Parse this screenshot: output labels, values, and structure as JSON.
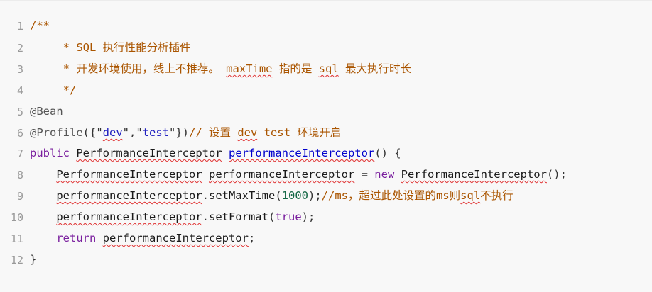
{
  "line_numbers": [
    "1",
    "2",
    "3",
    "4",
    "5",
    "6",
    "7",
    "8",
    "9",
    "10",
    "11",
    "12"
  ],
  "code": {
    "l1": {
      "open": "/**"
    },
    "l2": {
      "text": "     * SQL 执行性能分析插件"
    },
    "l3": {
      "pre": "     * 开发环境使用，线上不推荐。 ",
      "w1": "maxTime",
      "mid": " 指的是 ",
      "w2": "sql",
      "post": " 最大执行时长"
    },
    "l4": {
      "close": "     */"
    },
    "l5": {
      "annotation": "@Bean"
    },
    "l6": {
      "annotation": "@Profile",
      "p1": "({\"",
      "s1": "dev",
      "p2": "\",\"",
      "s2": "test",
      "p3": "\"})",
      "c_pre": "// 设置 ",
      "c_w": "dev",
      "c_post": " test 环境开启"
    },
    "l7": {
      "kw": "public",
      "sp1": " ",
      "type": "PerformanceInterceptor",
      "sp2": " ",
      "method": "performanceInterceptor",
      "rest": "() {"
    },
    "l8": {
      "indent": "    ",
      "type": "PerformanceInterceptor",
      "sp": " ",
      "var": "performanceInterceptor",
      "eq": " = ",
      "kw": "new",
      "sp2": " ",
      "ctor": "PerformanceInterceptor",
      "end": "();"
    },
    "l9": {
      "indent": "    ",
      "obj": "performanceInterceptor",
      "dot": ".",
      "call": "setMaxTime",
      "open": "(",
      "num": "1000",
      "close": ");",
      "c_pre": "//ms，超过此处设置的ms则",
      "c_w": "sql",
      "c_post": "不执行"
    },
    "l10": {
      "indent": "    ",
      "obj": "performanceInterceptor",
      "dot": ".",
      "call": "setFormat",
      "open": "(",
      "kw": "true",
      "close": ");"
    },
    "l11": {
      "indent": "    ",
      "kw": "return",
      "sp": " ",
      "obj": "performanceInterceptor",
      "end": ";"
    },
    "l12": {
      "brace": "}"
    }
  },
  "colors": {
    "comment": "#aa5500",
    "keyword": "#7a1f9e",
    "string": "#2020c0",
    "number": "#116644",
    "background": "#f8f8f8",
    "spellcheck": "#e03030"
  }
}
